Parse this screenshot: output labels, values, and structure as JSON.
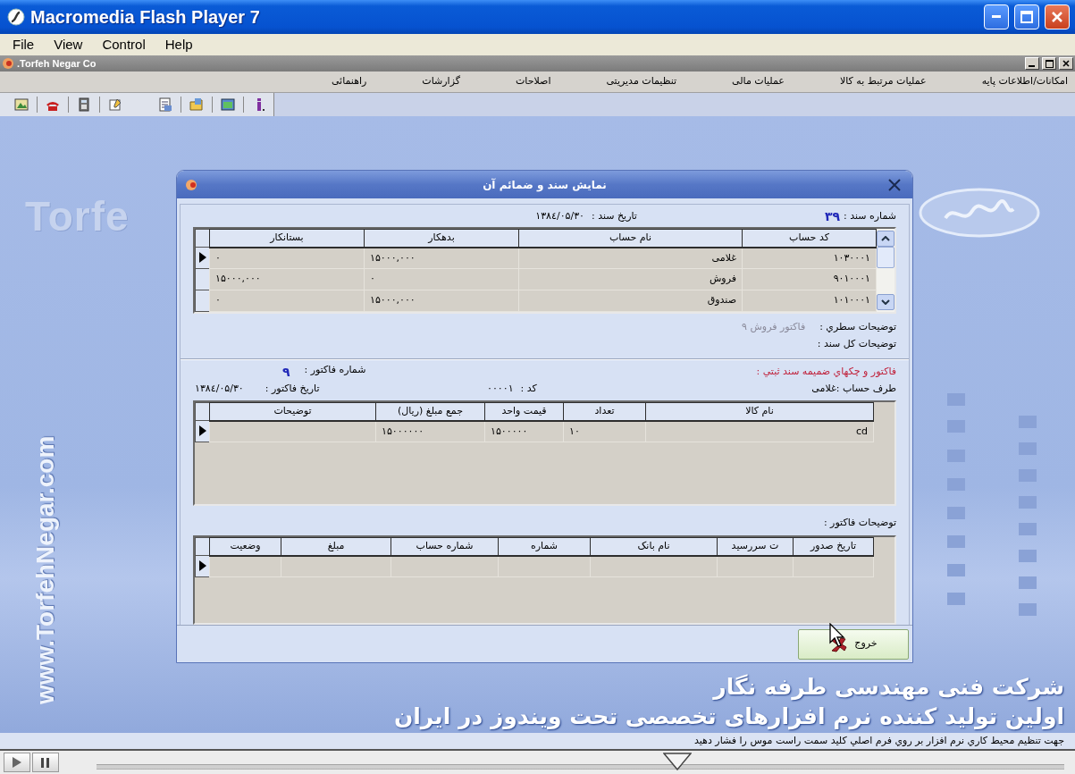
{
  "window": {
    "title": "Macromedia Flash Player 7"
  },
  "menu": {
    "file": "File",
    "view": "View",
    "control": "Control",
    "help": "Help"
  },
  "app_window": {
    "title": ".Torfeh Negar Co"
  },
  "app_menu": [
    "امکانات/اطلاعات پایه",
    "عملیات مرتبط به کالا",
    "عملیات مالی",
    "تنظیمات مدیریتی",
    "اصلاحات",
    "گزارشات",
    "راهنمائی"
  ],
  "background": {
    "logo_text": "Torfe",
    "url_text": "www.TorfehNegar.com",
    "company_lines": [
      "شرکت فنی مهندسی طرفه نگار",
      "اولین تولید کننده نرم افزارهای تخصصی تحت ویندوز در ایران"
    ]
  },
  "dialog": {
    "title": "نمایش سند و ضمائم آن",
    "voucher_number_label": "شماره سند :",
    "voucher_number": "۳۹",
    "voucher_date_label": "تاریخ سند :",
    "voucher_date": "۱۳۸٤/۰۵/۳۰",
    "entries": {
      "columns": [
        "کد حساب",
        "نام حساب",
        "بدهکار",
        "بستانکار"
      ],
      "rows": [
        {
          "selected": true,
          "cells": [
            "۱۰۳۰۰۰۱",
            "غلامی",
            "۱۵۰۰۰,۰۰۰",
            "۰"
          ]
        },
        {
          "selected": false,
          "cells": [
            "۹۰۱۰۰۰۱",
            "فروش",
            "۰",
            "۱۵۰۰۰,۰۰۰"
          ]
        },
        {
          "selected": false,
          "cells": [
            "۱۰۱۰۰۰۱",
            "صندوق",
            "۱۵۰۰۰,۰۰۰",
            "۰"
          ]
        }
      ]
    },
    "line_description_label": "توضیحات سطري :",
    "line_description": "فاکتور فروش ۹",
    "general_description_label": "توضیحات کل سند :",
    "attachments_heading": "فاکتور و چکهاي ضميمه سند ثبتي :",
    "invoice_number_label": "شماره فاکتور :",
    "invoice_number": "۹",
    "party_label": "طرف حساب :",
    "party": "غلامی",
    "code_label": "کد :",
    "code": "۰۰۰۰۱",
    "invoice_date_label": "تاریخ فاکتور :",
    "invoice_date": "۱۳۸٤/۰۵/۳۰",
    "items": {
      "columns": [
        "نام کالا",
        "تعداد",
        "قیمت واحد",
        "جمع مبلغ (ریال)",
        "توضیحات"
      ],
      "rows": [
        {
          "selected": true,
          "cells": [
            "cd",
            "۱۰",
            "۱۵۰۰۰۰۰",
            "۱۵۰۰۰۰۰۰"
          ]
        }
      ]
    },
    "invoice_description_label": "توضیحات فاکتور :",
    "cheques": {
      "columns": [
        "تاریخ صدور",
        "ت سررسید",
        "نام بانک",
        "شماره",
        "شماره حساب",
        "مبلغ",
        "وضعیت"
      ],
      "rows": [
        {
          "selected": true
        }
      ]
    },
    "exit_button": "خروج"
  },
  "status_text": "جهت تنظیم محیط کاري نرم افزار بر روي فرم اصلي کليد سمت راست موس را فشار دهيد",
  "player": {
    "seek": {
      "level": 0.6
    }
  }
}
